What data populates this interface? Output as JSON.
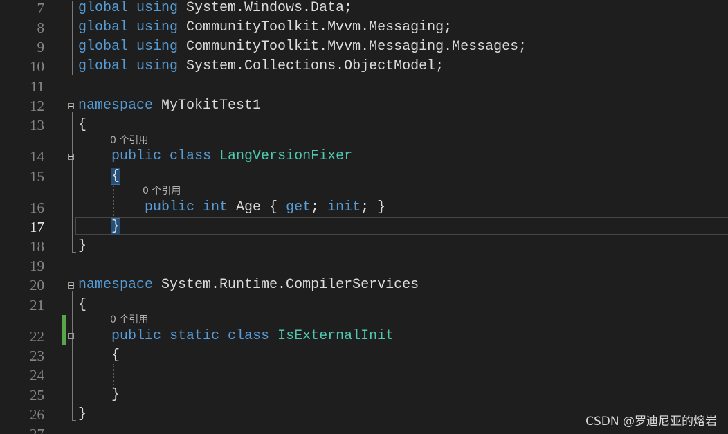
{
  "lines": [
    {
      "num": "7",
      "code": [
        {
          "t": "global ",
          "c": "kw"
        },
        {
          "t": "using ",
          "c": "kw"
        },
        {
          "t": "System.Windows.Data;"
        }
      ]
    },
    {
      "num": "8",
      "code": [
        {
          "t": "global ",
          "c": "kw"
        },
        {
          "t": "using ",
          "c": "kw"
        },
        {
          "t": "CommunityToolkit.Mvvm.Messaging;"
        }
      ]
    },
    {
      "num": "9",
      "code": [
        {
          "t": "global ",
          "c": "kw"
        },
        {
          "t": "using ",
          "c": "kw"
        },
        {
          "t": "CommunityToolkit.Mvvm.Messaging.Messages;"
        }
      ]
    },
    {
      "num": "10",
      "code": [
        {
          "t": "global ",
          "c": "kw"
        },
        {
          "t": "using ",
          "c": "kw"
        },
        {
          "t": "System.Collections.ObjectModel;"
        }
      ]
    },
    {
      "num": "11",
      "code": []
    },
    {
      "num": "12",
      "code": [
        {
          "t": "namespace ",
          "c": "kw"
        },
        {
          "t": "MyTokitTest1"
        }
      ]
    },
    {
      "num": "13",
      "code": [
        {
          "t": "{"
        }
      ]
    },
    {
      "num": "14",
      "code": [
        {
          "t": "    "
        },
        {
          "t": "public ",
          "c": "kw"
        },
        {
          "t": "class ",
          "c": "kw"
        },
        {
          "t": "LangVersionFixer",
          "c": "ty"
        }
      ]
    },
    {
      "num": "15",
      "code": [
        {
          "t": "    "
        },
        {
          "t": "{",
          "c": "bracehl"
        }
      ]
    },
    {
      "num": "16",
      "code": [
        {
          "t": "        "
        },
        {
          "t": "public ",
          "c": "kw"
        },
        {
          "t": "int ",
          "c": "kw"
        },
        {
          "t": "Age { "
        },
        {
          "t": "get",
          "c": "kw"
        },
        {
          "t": "; "
        },
        {
          "t": "init",
          "c": "kw"
        },
        {
          "t": "; }"
        }
      ]
    },
    {
      "num": "17",
      "code": [
        {
          "t": "    "
        },
        {
          "t": "}",
          "c": "bracehl"
        }
      ]
    },
    {
      "num": "18",
      "code": [
        {
          "t": "}"
        }
      ]
    },
    {
      "num": "19",
      "code": []
    },
    {
      "num": "20",
      "code": [
        {
          "t": "namespace ",
          "c": "kw"
        },
        {
          "t": "System.Runtime.CompilerServices"
        }
      ]
    },
    {
      "num": "21",
      "code": [
        {
          "t": "{"
        }
      ]
    },
    {
      "num": "22",
      "code": [
        {
          "t": "    "
        },
        {
          "t": "public ",
          "c": "kw"
        },
        {
          "t": "static ",
          "c": "kw"
        },
        {
          "t": "class ",
          "c": "kw"
        },
        {
          "t": "IsExternalInit",
          "c": "ty"
        }
      ]
    },
    {
      "num": "23",
      "code": [
        {
          "t": "    {"
        }
      ]
    },
    {
      "num": "24",
      "code": []
    },
    {
      "num": "25",
      "code": [
        {
          "t": "    }"
        }
      ]
    },
    {
      "num": "26",
      "code": [
        {
          "t": "}"
        }
      ]
    },
    {
      "num": "27",
      "code": []
    }
  ],
  "codelens": {
    "class_refs": "0 个引用",
    "property_refs": "0 个引用",
    "static_class_refs": "0 个引用"
  },
  "current_line": "17",
  "watermark": "CSDN @罗迪尼亚的熔岩",
  "colors": {
    "background": "#1e1e1e",
    "keyword": "#569cd6",
    "type": "#4ec9b0",
    "identifier": "#dcdcdc",
    "line_number": "#858585",
    "change_marker": "#57a64a"
  }
}
